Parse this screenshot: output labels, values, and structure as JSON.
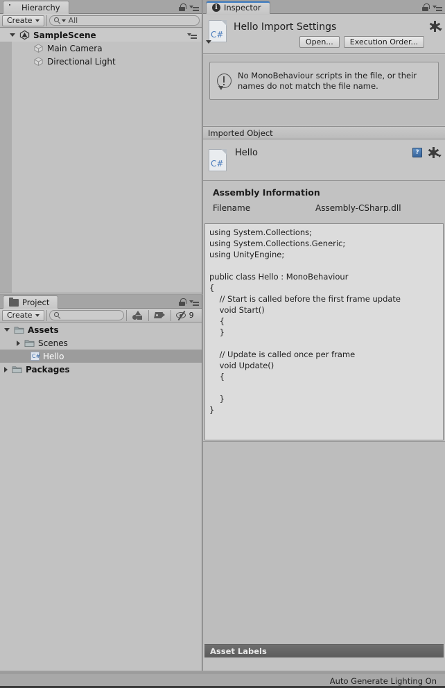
{
  "window": {
    "status_text": "Auto Generate Lighting On"
  },
  "hierarchy": {
    "tab_label": "Hierarchy",
    "tab_icon": "hierarchy-icon",
    "lock_icon": "lock-icon",
    "menu_icon": "hamburger-menu-icon",
    "create_label": "Create",
    "search_placeholder": "All",
    "search_value": "",
    "scene": {
      "name": "SampleScene",
      "expanded": true,
      "menu_icon": "hamburger-menu-icon"
    },
    "items": [
      {
        "label": "Main Camera",
        "icon": "cube-icon"
      },
      {
        "label": "Directional Light",
        "icon": "cube-icon"
      }
    ]
  },
  "project": {
    "tab_label": "Project",
    "tab_icon": "folder-icon",
    "lock_icon": "lock-icon",
    "menu_icon": "hamburger-menu-icon",
    "create_label": "Create",
    "search_placeholder": "",
    "search_value": "",
    "filter_type_icon": "type-filter-icon",
    "filter_label_icon": "label-filter-icon",
    "visibility_icon": "eye-off-icon",
    "visibility_count": "9",
    "tree": [
      {
        "label": "Assets",
        "icon": "folder-icon",
        "depth": 0,
        "expanded": true,
        "bold": true,
        "selected": false
      },
      {
        "label": "Scenes",
        "icon": "folder-icon",
        "depth": 1,
        "expanded": false,
        "bold": false,
        "selected": false
      },
      {
        "label": "Hello",
        "icon": "csharp-icon",
        "depth": 2,
        "expanded": null,
        "bold": false,
        "selected": true
      },
      {
        "label": "Packages",
        "icon": "folder-icon",
        "depth": 0,
        "expanded": false,
        "bold": true,
        "selected": false
      }
    ]
  },
  "inspector": {
    "tab_label": "Inspector",
    "tab_icon": "info-icon",
    "lock_icon": "lock-icon",
    "menu_icon": "hamburger-menu-icon",
    "import_settings": {
      "title": "Hello Import Settings",
      "icon": "csharp-file-icon",
      "gear_icon": "gear-icon",
      "open_button": "Open...",
      "execution_order_button": "Execution Order..."
    },
    "warning": {
      "icon": "warning-icon",
      "message": "No MonoBehaviour scripts in the file, or their names do not match the file name."
    },
    "imported_object": {
      "header": "Imported Object",
      "name": "Hello",
      "icon": "csharp-file-icon",
      "help_icon": "help-book-icon",
      "gear_icon": "gear-icon"
    },
    "assembly_information": {
      "header": "Assembly Information",
      "rows": [
        {
          "label": "Filename",
          "value": "Assembly-CSharp.dll"
        }
      ]
    },
    "code_preview": "using System.Collections;\nusing System.Collections.Generic;\nusing UnityEngine;\n\npublic class Hello : MonoBehaviour\n{\n    // Start is called before the first frame update\n    void Start()\n    {\n    }\n\n    // Update is called once per frame\n    void Update()\n    {\n\n    }\n}",
    "asset_labels": "Asset Labels"
  },
  "colors": {
    "panel_bg": "#c2c2c2",
    "chrome_bg": "#a5a5a5",
    "accent_blue": "#3d7dc4",
    "selection": "#9c9c9c",
    "dark_bar": "#6e6e6e"
  }
}
